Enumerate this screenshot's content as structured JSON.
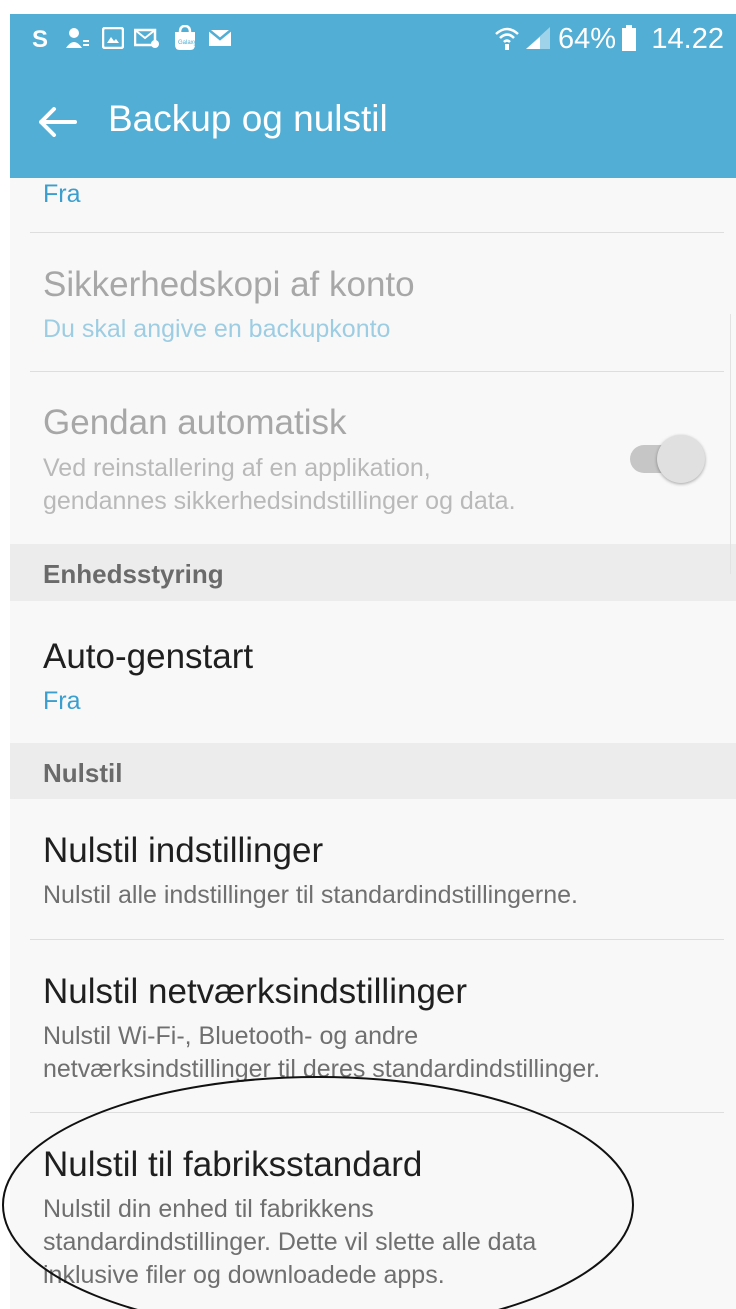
{
  "status_bar": {
    "left_icons": [
      "skype-icon",
      "account-icon",
      "gallery-icon",
      "mail-settings-icon",
      "galaxy-apps-icon",
      "email-icon"
    ],
    "right_icons": [
      "wifi-icon",
      "signal-icon"
    ],
    "battery_text": "64%",
    "time": "14.22"
  },
  "app_bar": {
    "back_icon": "arrow-left-icon",
    "title": "Backup og nulstil"
  },
  "list": {
    "top_partial": {
      "subtitle": "Fra"
    },
    "account_backup": {
      "title": "Sikkerhedskopi af konto",
      "subtitle": "Du skal angive en backupkonto"
    },
    "auto_restore": {
      "title": "Gendan automatisk",
      "subtitle_line1": "Ved reinstallering af en applikation,",
      "subtitle_line2": "gendannes sikkerhedsindstillinger og data.",
      "toggle_on": true
    },
    "section_device": "Enhedsstyring",
    "auto_restart": {
      "title": "Auto-genstart",
      "subtitle": "Fra"
    },
    "section_reset": "Nulstil",
    "reset_settings": {
      "title": "Nulstil indstillinger",
      "subtitle": "Nulstil alle indstillinger til standardindstillingerne."
    },
    "reset_network": {
      "title": "Nulstil netværksindstillinger",
      "subtitle_line1": "Nulstil Wi-Fi-, Bluetooth- og andre",
      "subtitle_line2": "netværksindstillinger til deres standardindstillinger."
    },
    "factory_reset": {
      "title": "Nulstil til fabriksstandard",
      "subtitle_line1": "Nulstil din enhed til fabrikkens",
      "subtitle_line2": "standardindstillinger. Dette vil slette alle data",
      "subtitle_line3": "inklusive filer og downloadede apps."
    }
  },
  "colors": {
    "app_bar": "#52aed4",
    "accent_text": "#3a9fce",
    "background": "#f8f8f8",
    "section_header": "#ececec"
  }
}
